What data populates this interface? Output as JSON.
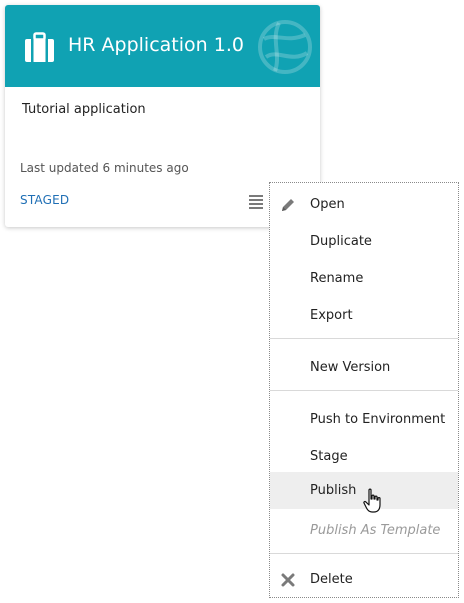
{
  "card": {
    "title": "HR Application 1.0",
    "description": "Tutorial application",
    "updated": "Last updated 6 minutes ago",
    "status": "STAGED",
    "header_color": "#10a2b3",
    "status_color": "#1f6fb5"
  },
  "menu": {
    "items": [
      {
        "label": "Open",
        "icon": "pencil-icon"
      },
      {
        "label": "Duplicate"
      },
      {
        "label": "Rename"
      },
      {
        "label": "Export"
      },
      {
        "label": "New Version"
      },
      {
        "label": "Push to Environment"
      },
      {
        "label": "Stage"
      },
      {
        "label": "Publish",
        "state": "hovered"
      },
      {
        "label": "Publish As Template",
        "state": "disabled"
      },
      {
        "label": "Delete",
        "icon": "close-icon"
      }
    ]
  }
}
